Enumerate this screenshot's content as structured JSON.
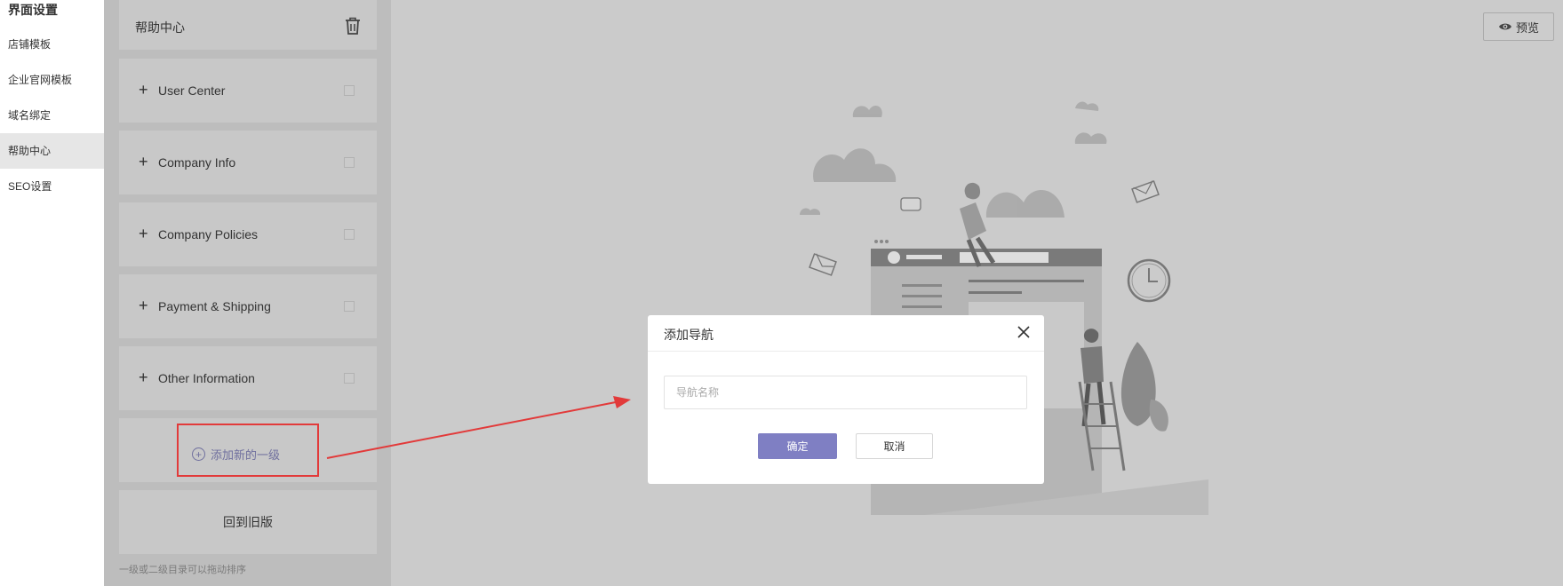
{
  "sidebar": {
    "title": "界面设置",
    "items": [
      {
        "label": "店铺模板"
      },
      {
        "label": "企业官网模板"
      },
      {
        "label": "域名绑定"
      },
      {
        "label": "帮助中心"
      },
      {
        "label": "SEO设置"
      }
    ],
    "active_index": 3
  },
  "nav_panel": {
    "header_label": "帮助中心",
    "items": [
      {
        "label": "User Center"
      },
      {
        "label": "Company Info"
      },
      {
        "label": "Company Policies"
      },
      {
        "label": "Payment & Shipping"
      },
      {
        "label": "Other Information"
      }
    ],
    "add_label": "添加新的一级",
    "old_version_label": "回到旧版",
    "hint": "一级或二级目录可以拖动排序"
  },
  "toolbar": {
    "preview_label": "预览"
  },
  "modal": {
    "title": "添加导航",
    "input_placeholder": "导航名称",
    "input_value": "",
    "ok_label": "确定",
    "cancel_label": "取消"
  },
  "colors": {
    "accent": "#7f7fc3",
    "highlight": "#e23a3a",
    "overlay": "#cbcbcb"
  }
}
